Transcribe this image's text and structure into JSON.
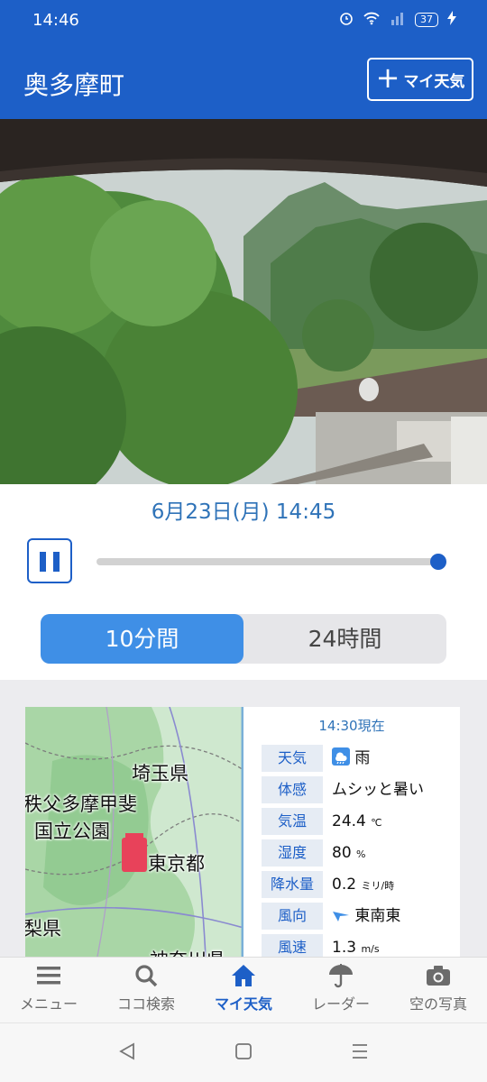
{
  "status_bar": {
    "time": "14:46",
    "battery": "37"
  },
  "header": {
    "title": "奥多摩町",
    "my_weather_button": "マイ天気"
  },
  "live_camera": {
    "timestamp": "6月23日(月) 14:45",
    "playback_position": 1.0
  },
  "interval_toggle": {
    "options": [
      "10分間",
      "24時間"
    ],
    "selected": "10分間"
  },
  "map": {
    "labels": [
      "埼玉県",
      "秩父多摩甲斐",
      "国立公園",
      "東京都",
      "梨県",
      "神奈川県"
    ]
  },
  "observation": {
    "time": "14:30現在",
    "rows": [
      {
        "label": "天気",
        "value": "雨",
        "icon": "rain-icon"
      },
      {
        "label": "体感",
        "value": "ムシッと暑い"
      },
      {
        "label": "気温",
        "value": "24.4",
        "unit": "℃"
      },
      {
        "label": "湿度",
        "value": "80",
        "unit": "%"
      },
      {
        "label": "降水量",
        "value": "0.2",
        "unit": "ミリ/時"
      },
      {
        "label": "風向",
        "value": "東南東",
        "icon": "wind-direction-icon"
      },
      {
        "label": "風速",
        "value": "1.3",
        "unit": "m/s"
      }
    ]
  },
  "bottom_nav": [
    {
      "label": "メニュー",
      "icon": "menu-icon"
    },
    {
      "label": "ココ検索",
      "icon": "search-icon"
    },
    {
      "label": "マイ天気",
      "icon": "home-icon",
      "active": true
    },
    {
      "label": "レーダー",
      "icon": "umbrella-icon"
    },
    {
      "label": "空の写真",
      "icon": "camera-icon"
    }
  ],
  "colors": {
    "primary": "#1d5fc7",
    "toggle_active": "#3f8fe6",
    "accent_text": "#2f73b8",
    "map_marker": "#e8425a"
  }
}
